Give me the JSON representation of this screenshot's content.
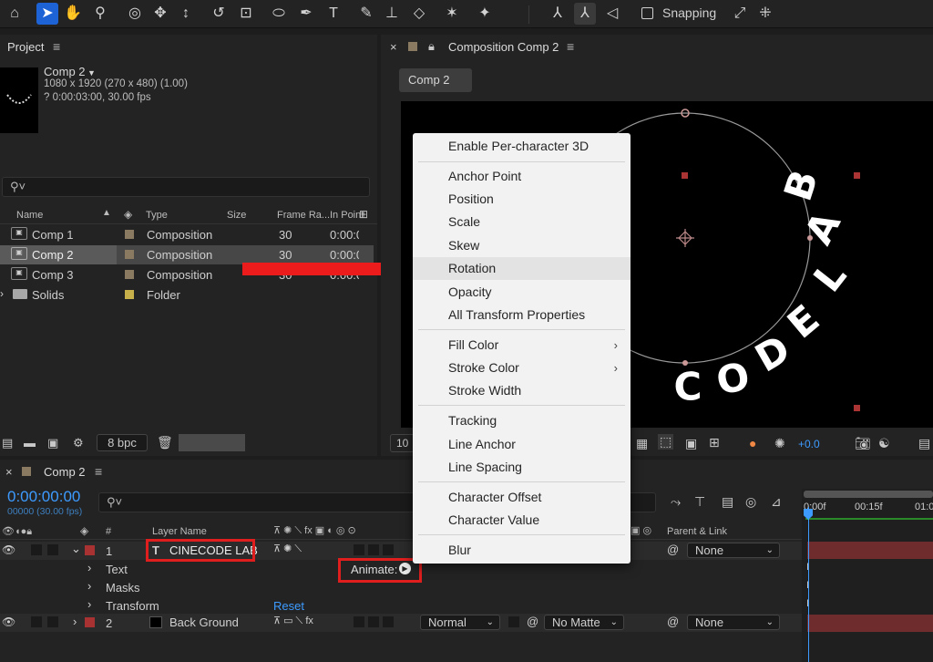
{
  "toolbar": {
    "tools": [
      "home-icon",
      "selection-arrow-icon",
      "hand-icon",
      "zoom-icon",
      "orbit-camera-icon",
      "pan-camera-icon",
      "dolly-camera-icon",
      "rotate-icon",
      "pan-behind-icon",
      "ellipse-icon",
      "pen-icon",
      "type-icon",
      "brush-icon",
      "clone-stamp-icon",
      "eraser-icon",
      "roto-brush-icon",
      "puppet-pin-icon",
      "axis-local-icon",
      "axis-world-icon",
      "axis-view-icon",
      "snap-expand-icon",
      "snap-grid-icon"
    ],
    "snapping_label": "Snapping"
  },
  "project": {
    "title": "Project",
    "comp_name": "Comp 2",
    "comp_dims": "1080 x 1920  (270 x 480) (1.00)",
    "comp_duration": "? 0:00:03:00, 30.00 fps",
    "search_placeholder": "",
    "columns": [
      "Name",
      "Type",
      "Size",
      "Frame Ra...",
      "In Point"
    ],
    "items": [
      {
        "name": "Comp 1",
        "type": "Composition",
        "fps": "30",
        "in": "0:00:0",
        "color": "#8a7a62"
      },
      {
        "name": "Comp 2",
        "type": "Composition",
        "fps": "30",
        "in": "0:00:0",
        "color": "#8a7a62"
      },
      {
        "name": "Comp 3",
        "type": "Composition",
        "fps": "30",
        "in": "0:00:0",
        "color": "#8a7a62"
      },
      {
        "name": "Solids",
        "type": "Folder",
        "fps": "",
        "in": "",
        "color": "#c7b04a"
      }
    ],
    "bpc": "8 bpc"
  },
  "viewer": {
    "title": "Composition Comp 2",
    "tab": "Comp 2",
    "zoom": "10",
    "exposure": "+0.0",
    "text_content": "CINECODE LAB"
  },
  "menu": {
    "items": [
      {
        "label": "Enable Per-character 3D"
      },
      {
        "label": "Anchor Point"
      },
      {
        "label": "Position"
      },
      {
        "label": "Scale"
      },
      {
        "label": "Skew"
      },
      {
        "label": "Rotation"
      },
      {
        "label": "Opacity"
      },
      {
        "label": "All Transform Properties"
      },
      {
        "label": "Fill Color",
        "arrow": "›"
      },
      {
        "label": "Stroke Color",
        "arrow": "›"
      },
      {
        "label": "Stroke Width"
      },
      {
        "label": "Tracking"
      },
      {
        "label": "Line Anchor"
      },
      {
        "label": "Line Spacing"
      },
      {
        "label": "Character Offset"
      },
      {
        "label": "Character Value"
      },
      {
        "label": "Blur"
      }
    ]
  },
  "timeline": {
    "comp_tab": "Comp 2",
    "timecode": "0:00:00:00",
    "frames": "00000 (30.00 fps)",
    "col_layer_name": "Layer Name",
    "col_parent": "Parent & Link",
    "ruler": [
      "0:00f",
      "00:15f",
      "01:0"
    ],
    "layers": [
      {
        "num": "1",
        "name": "CINECODE LAB",
        "parent": "None",
        "color": "#a83232"
      },
      {
        "num": "2",
        "name": "Back Ground",
        "mode": "Normal",
        "matte": "No Matte",
        "parent": "None",
        "color": "#a83232"
      }
    ],
    "props": [
      "Text",
      "Masks",
      "Transform"
    ],
    "animate_label": "Animate:",
    "reset_label": "Reset"
  },
  "colors": {
    "accent": "#1e63d6",
    "highlight_red": "#e01e1e",
    "timecode_blue": "#3d9bff"
  }
}
